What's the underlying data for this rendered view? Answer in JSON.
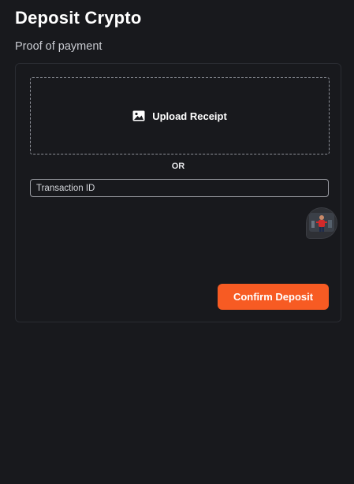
{
  "page": {
    "title": "Deposit Crypto",
    "section_label": "Proof of payment"
  },
  "upload": {
    "label": "Upload Receipt",
    "icon": "image-icon"
  },
  "divider": {
    "text": "OR"
  },
  "transaction": {
    "placeholder": "Transaction ID",
    "value": ""
  },
  "avatar": {
    "icon": "chat-avatar"
  },
  "actions": {
    "confirm_label": "Confirm Deposit"
  },
  "colors": {
    "background": "#18191d",
    "card_border": "#2a2c32",
    "accent": "#f75b23",
    "text": "#ffffff",
    "muted_text": "#c9cbd1"
  }
}
